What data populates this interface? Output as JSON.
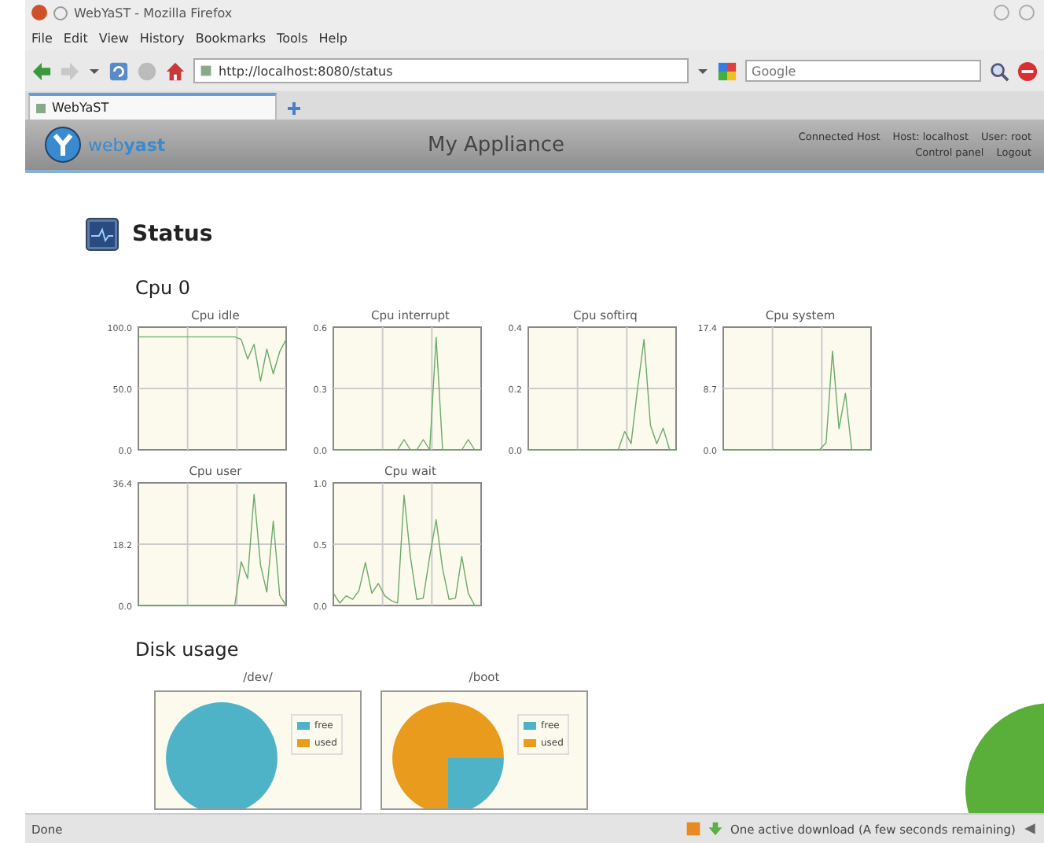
{
  "window": {
    "title": "WebYaST - Mozilla Firefox"
  },
  "menu": [
    "File",
    "Edit",
    "View",
    "History",
    "Bookmarks",
    "Tools",
    "Help"
  ],
  "toolbar": {
    "url": "http://localhost:8080/status",
    "search_placeholder": "Google"
  },
  "tabs": [
    {
      "label": "WebYaST",
      "selected": true
    }
  ],
  "header": {
    "logo": "web**yast**",
    "title": "My Appliance",
    "links_top": [
      "Connected Host",
      "Host: localhost",
      "User: root"
    ],
    "links_bottom": [
      "Control panel",
      "Logout"
    ]
  },
  "page": {
    "title": "Status",
    "cpu_heading": "Cpu 0",
    "disk_heading": "Disk usage"
  },
  "cpu_charts": [
    {
      "chart_data": {
        "type": "line",
        "title": "Cpu idle",
        "ylim": [
          0,
          100
        ],
        "yticks": [
          {
            "value": 0,
            "label": "0.0"
          },
          {
            "value": 50,
            "label": "50.0"
          },
          {
            "value": 100,
            "label": "100.0"
          }
        ],
        "series": [
          {
            "color": "#6aaa6a",
            "values": [
              92,
              92,
              92,
              92,
              92,
              92,
              92,
              92,
              92,
              92,
              92,
              92,
              92,
              92,
              92,
              92,
              90,
              74,
              86,
              56,
              82,
              62,
              80,
              90
            ]
          }
        ]
      }
    },
    {
      "chart_data": {
        "type": "line",
        "title": "Cpu interrupt",
        "ylim": [
          0,
          0.6
        ],
        "yticks": [
          {
            "value": 0,
            "label": "0.0"
          },
          {
            "value": 0.3,
            "label": "0.3"
          },
          {
            "value": 0.6,
            "label": "0.6"
          }
        ],
        "series": [
          {
            "color": "#6aaa6a",
            "values": [
              0,
              0,
              0,
              0,
              0,
              0,
              0,
              0,
              0,
              0,
              0,
              0.05,
              0,
              0,
              0.05,
              0,
              0.55,
              0,
              0,
              0,
              0,
              0.05,
              0,
              0
            ]
          }
        ]
      }
    },
    {
      "chart_data": {
        "type": "line",
        "title": "Cpu softirq",
        "ylim": [
          0,
          0.4
        ],
        "yticks": [
          {
            "value": 0,
            "label": "0.0"
          },
          {
            "value": 0.2,
            "label": "0.2"
          },
          {
            "value": 0.4,
            "label": "0.4"
          }
        ],
        "series": [
          {
            "color": "#6aaa6a",
            "values": [
              0,
              0,
              0,
              0,
              0,
              0,
              0,
              0,
              0,
              0,
              0,
              0,
              0,
              0,
              0,
              0.06,
              0.02,
              0.2,
              0.36,
              0.08,
              0.02,
              0.07,
              0,
              0
            ]
          }
        ]
      }
    },
    {
      "chart_data": {
        "type": "line",
        "title": "Cpu system",
        "ylim": [
          0,
          17.4
        ],
        "yticks": [
          {
            "value": 0,
            "label": "0.0"
          },
          {
            "value": 8.7,
            "label": "8.7"
          },
          {
            "value": 17.4,
            "label": "17.4"
          }
        ],
        "series": [
          {
            "color": "#6aaa6a",
            "values": [
              0,
              0,
              0,
              0,
              0,
              0,
              0,
              0,
              0,
              0,
              0,
              0,
              0,
              0,
              0,
              0,
              1,
              14,
              3,
              8,
              0,
              0,
              0,
              0
            ]
          }
        ]
      }
    },
    {
      "chart_data": {
        "type": "line",
        "title": "Cpu user",
        "ylim": [
          0,
          36.4
        ],
        "yticks": [
          {
            "value": 0,
            "label": "0.0"
          },
          {
            "value": 18.2,
            "label": "18.2"
          },
          {
            "value": 36.4,
            "label": "36.4"
          }
        ],
        "series": [
          {
            "color": "#6aaa6a",
            "values": [
              0,
              0,
              0,
              0,
              0,
              0,
              0,
              0,
              0,
              0,
              0,
              0,
              0,
              0,
              0,
              0,
              13,
              8,
              33,
              12,
              4,
              25,
              3,
              0
            ]
          }
        ]
      }
    },
    {
      "chart_data": {
        "type": "line",
        "title": "Cpu wait",
        "ylim": [
          0,
          1
        ],
        "yticks": [
          {
            "value": 0,
            "label": "0.0"
          },
          {
            "value": 0.5,
            "label": "0.5"
          },
          {
            "value": 1,
            "label": "1.0"
          }
        ],
        "series": [
          {
            "color": "#6aaa6a",
            "values": [
              0.1,
              0.02,
              0.08,
              0.05,
              0.12,
              0.35,
              0.1,
              0.18,
              0.08,
              0.04,
              0.02,
              0.9,
              0.4,
              0.05,
              0.06,
              0.4,
              0.7,
              0.3,
              0.05,
              0.06,
              0.4,
              0.1,
              0,
              0
            ]
          }
        ]
      }
    }
  ],
  "disk_charts": [
    {
      "title": "/dev/",
      "chart_data": {
        "type": "pie",
        "categories": [
          "free",
          "used"
        ],
        "values": [
          100,
          0
        ],
        "legend": "right"
      }
    },
    {
      "title": "/boot",
      "chart_data": {
        "type": "pie",
        "categories": [
          "free",
          "used"
        ],
        "values": [
          25,
          75
        ],
        "legend": "right"
      }
    }
  ],
  "status_bar": {
    "text": "Done",
    "download": "One active download (A few seconds remaining)"
  }
}
